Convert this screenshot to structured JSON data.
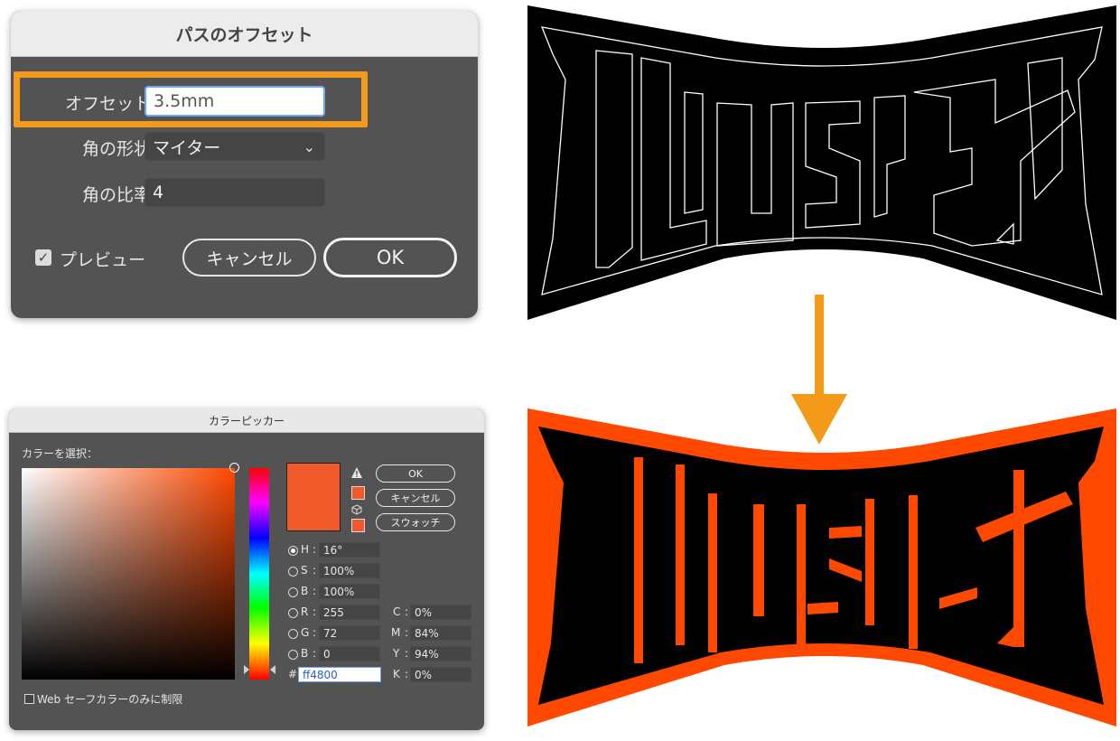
{
  "offset_dialog": {
    "title": "パスのオフセット",
    "offset_label": "オフセット：",
    "offset_value": "3.5mm",
    "joins_label": "角の形状：",
    "joins_value": "マイター",
    "miter_label": "角の比率：",
    "miter_value": "4",
    "preview_label": "プレビュー",
    "cancel_label": "キャンセル",
    "ok_label": "OK",
    "highlight_color": "#f39a1a"
  },
  "color_picker": {
    "title": "カラーピッカー",
    "select_label": "カラーを選択：",
    "ok_label": "OK",
    "cancel_label": "キャンセル",
    "swatches_label": "スウォッチ",
    "hsb": [
      {
        "label": "H",
        "value": "16°",
        "selected": true
      },
      {
        "label": "S",
        "value": "100%",
        "selected": false
      },
      {
        "label": "B",
        "value": "100%",
        "selected": false
      }
    ],
    "rgb": [
      {
        "label": "R",
        "value": "255"
      },
      {
        "label": "G",
        "value": "72"
      },
      {
        "label": "B",
        "value": "0"
      }
    ],
    "cmyk": [
      {
        "label": "C",
        "value": "0%"
      },
      {
        "label": "M",
        "value": "84%"
      },
      {
        "label": "Y",
        "value": "94%"
      },
      {
        "label": "K",
        "value": "0%"
      }
    ],
    "hex_prefix": "#",
    "hex_value": "ff4800",
    "web_safe_label": "Web セーフカラーのみに制限",
    "selected_color": "#ff4800"
  },
  "artwork": {
    "fill_color": "#000000",
    "offset_color": "#ff4800",
    "arrow_color": "#f39a1a"
  }
}
